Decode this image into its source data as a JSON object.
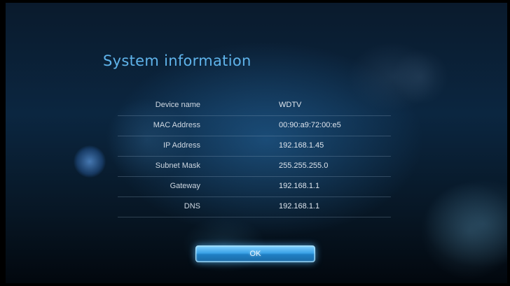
{
  "title": "System information",
  "rows": [
    {
      "label": "Device name",
      "value": "WDTV"
    },
    {
      "label": "MAC Address",
      "value": "00:90:a9:72:00:e5"
    },
    {
      "label": "IP Address",
      "value": "192.168.1.45"
    },
    {
      "label": "Subnet Mask",
      "value": "255.255.255.0"
    },
    {
      "label": "Gateway",
      "value": "192.168.1.1"
    },
    {
      "label": "DNS",
      "value": "192.168.1.1"
    }
  ],
  "ok_button": {
    "label": "OK"
  },
  "colors": {
    "title": "#5fb3ea",
    "button": "#3aa2e6",
    "text": "#cfd8e2"
  }
}
